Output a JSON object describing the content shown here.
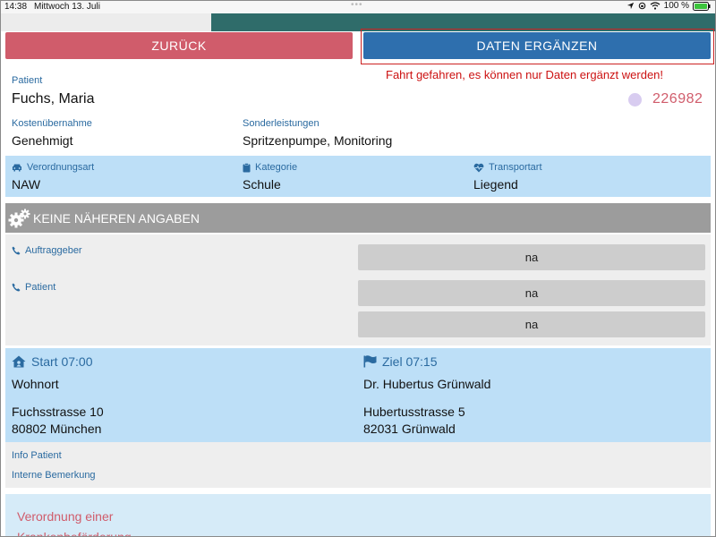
{
  "status_bar": {
    "time": "14:38",
    "date": "Mittwoch 13. Juli",
    "battery": "100 %"
  },
  "actions": {
    "back_label": "ZURÜCK",
    "complete_label": "DATEN ERGÄNZEN",
    "warning": "Fahrt gefahren, es können nur Daten ergänzt werden!"
  },
  "patient": {
    "label": "Patient",
    "name": "Fuchs, Maria",
    "order_number": "226982"
  },
  "billing": {
    "cost_label": "Kostenübernahme",
    "cost_value": "Genehmigt",
    "special_label": "Sonderleistungen",
    "special_value": "Spritzenpumpe, Monitoring"
  },
  "transport_info": {
    "prescription_label": "Verordnungsart",
    "prescription_value": "NAW",
    "category_label": "Kategorie",
    "category_value": "Schule",
    "transport_type_label": "Transportart",
    "transport_type_value": "Liegend"
  },
  "section": {
    "title": "KEINE NÄHEREN ANGABEN"
  },
  "contacts": {
    "client_label": "Auftraggeber",
    "client_value": "na",
    "patient_label": "Patient",
    "patient_value_1": "na",
    "patient_value_2": "na"
  },
  "route": {
    "start_label": "Start 07:00",
    "start_name": "Wohnort",
    "start_street": "Fuchsstrasse 10",
    "start_city": "80802 München",
    "goal_label": "Ziel 07:15",
    "goal_name": "Dr. Hubertus Grünwald",
    "goal_street": "Hubertusstrasse 5",
    "goal_city": "82031 Grünwald"
  },
  "notes": {
    "info_patient_label": "Info Patient",
    "internal_label": "Interne Bemerkung"
  },
  "bottom": {
    "title": "Verordnung einer",
    "title_line2": "Krankenbeförderung"
  },
  "colors": {
    "accent_blue": "#2e6fae",
    "accent_red": "#d05c6b",
    "label_blue": "#2a6aa0",
    "band_blue": "#bddff7",
    "warning_red": "#cc1111"
  }
}
